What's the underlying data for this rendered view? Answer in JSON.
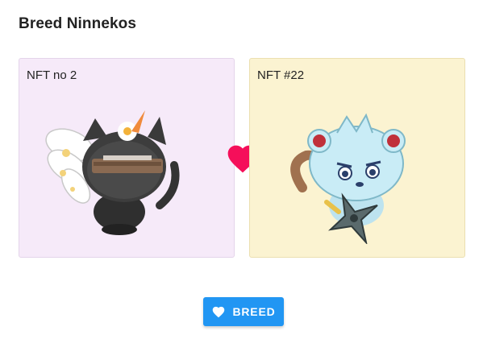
{
  "dialog": {
    "title": "Breed Ninnekos"
  },
  "cards": [
    {
      "label": "NFT no 2",
      "background": "#f6eaf9"
    },
    {
      "label": "NFT #22",
      "background": "#fbf3d1"
    }
  ],
  "heart_icon": "heart-icon",
  "breed_button": {
    "label": "BREED",
    "icon": "heart-icon",
    "color": "#2196f3"
  },
  "colors": {
    "heart": "#f50f5a"
  }
}
